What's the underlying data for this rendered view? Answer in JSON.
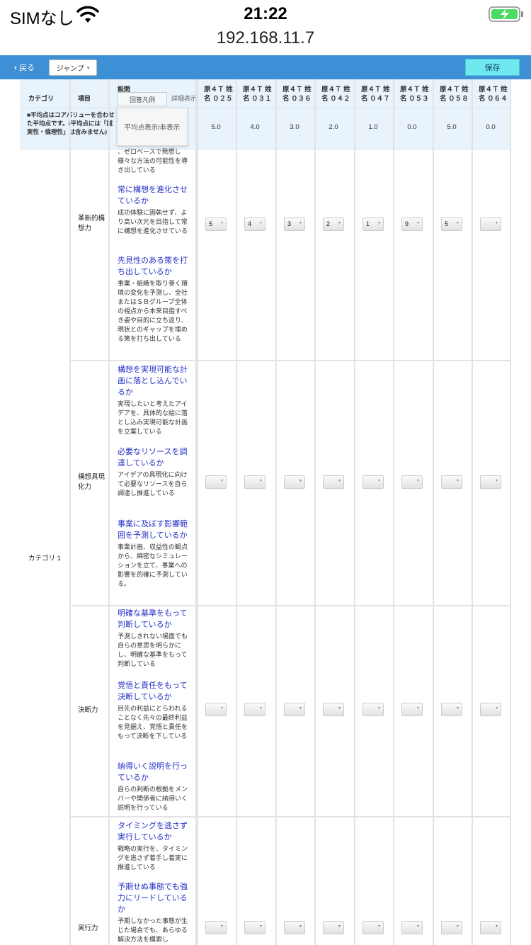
{
  "status": {
    "carrier": "SIMなし",
    "time": "21:22",
    "url": "192.168.11.7",
    "battery_color": "#4cd964"
  },
  "toolbar": {
    "back_label": "戻る",
    "jump_label": "ジャンプ",
    "save_label": "保存",
    "accent": "#3d8fd6",
    "save_color": "#6fe8ef"
  },
  "header": {
    "category": "カテゴリ",
    "item": "項目",
    "question": "設問",
    "legend_tab": "回答凡例",
    "detail_tab": "詳細表示",
    "avg_toggle": "平均点表示/非表示",
    "note": "■平均点はコアバリューを合わせた平均点です。(平均点には「誠実性・倫理性」は含みません)"
  },
  "people": [
    {
      "name": "原４Ｔ 姓 名 ０２５",
      "avg": "5.0"
    },
    {
      "name": "原４Ｔ 姓 名 ０３１",
      "avg": "4.0"
    },
    {
      "name": "原４Ｔ 姓 名 ０３６",
      "avg": "3.0"
    },
    {
      "name": "原４Ｔ 姓 名 ０４２",
      "avg": "2.0"
    },
    {
      "name": "原４Ｔ 姓 名 ０４７",
      "avg": "1.0"
    },
    {
      "name": "原４Ｔ 姓 名 ０５３",
      "avg": "0.0"
    },
    {
      "name": "原４Ｔ 姓 名 ０５８",
      "avg": "5.0"
    },
    {
      "name": "原４Ｔ 姓 名 ０６４",
      "avg": "0.0"
    }
  ],
  "category_label": "カテゴリ 1",
  "rows": [
    {
      "item": "革新的構想力",
      "scores": [
        "5",
        "4",
        "3",
        "2",
        "1",
        "9",
        "5",
        ""
      ],
      "questions": [
        {
          "title": "",
          "desc": "、ゼロベースで発想し様々な方法の可能性を導き出している"
        },
        {
          "title": "常に構想を進化させているか",
          "desc": "成功体験に固執せず、より高い次元を目指して常に構想を進化させている"
        },
        {
          "title": "先見性のある策を打ち出しているか",
          "desc": "事業・組織を取り巻く環境の変化を予測し、全社またはＳＢグループ全体の視点から本来目指すべき姿や目的に立ち返り、現状とのギャップを埋める策を打ち出している"
        }
      ]
    },
    {
      "item": "構想具現化力",
      "scores": [
        "",
        "",
        "",
        "",
        "",
        "",
        "",
        ""
      ],
      "questions": [
        {
          "title": "構想を実現可能な計画に落とし込んでいるか",
          "desc": "実現したいと考えたアイデアを、具体的な絵に落とし込み実現可能な計画を立案している"
        },
        {
          "title": "必要なリソースを調達しているか",
          "desc": "アイデアの具現化に向けて必要なリソースを自ら調達し推進している"
        },
        {
          "title": "事業に及ぼす影響範囲を予測しているか",
          "desc": "事業計画、収益性の観点から、綿密なシミュレーションを立て、事業への影響を的確に予測している。"
        }
      ]
    },
    {
      "item": "決断力",
      "scores": [
        "",
        "",
        "",
        "",
        "",
        "",
        "",
        ""
      ],
      "questions": [
        {
          "title": "明確な基準をもって判断しているか",
          "desc": "予測しきれない場面でも自らの意思を明らかにし、明確な基準をもって判断している"
        },
        {
          "title": "覚悟と責任をもって決断しているか",
          "desc": "目先の利益にとらわれることなく先々の最終利益を見据え、覚悟と責任をもって決断を下している"
        },
        {
          "title": "納得いく説明を行っているか",
          "desc": "自らの判断の根拠をメンバーや関係者に納得いく説明を行っている"
        }
      ]
    },
    {
      "item": "実行力",
      "scores": [
        "",
        "",
        "",
        "",
        "",
        "",
        "",
        ""
      ],
      "questions": [
        {
          "title": "タイミングを逃さず実行しているか",
          "desc": "戦略の実行を、タイミングを逃さず着手し着実に推進している"
        },
        {
          "title": "予期せぬ事態でも強力にリードしているか",
          "desc": "予期しなかった事態が生じた場合でも、あらゆる解決方法を模索し"
        }
      ]
    }
  ]
}
